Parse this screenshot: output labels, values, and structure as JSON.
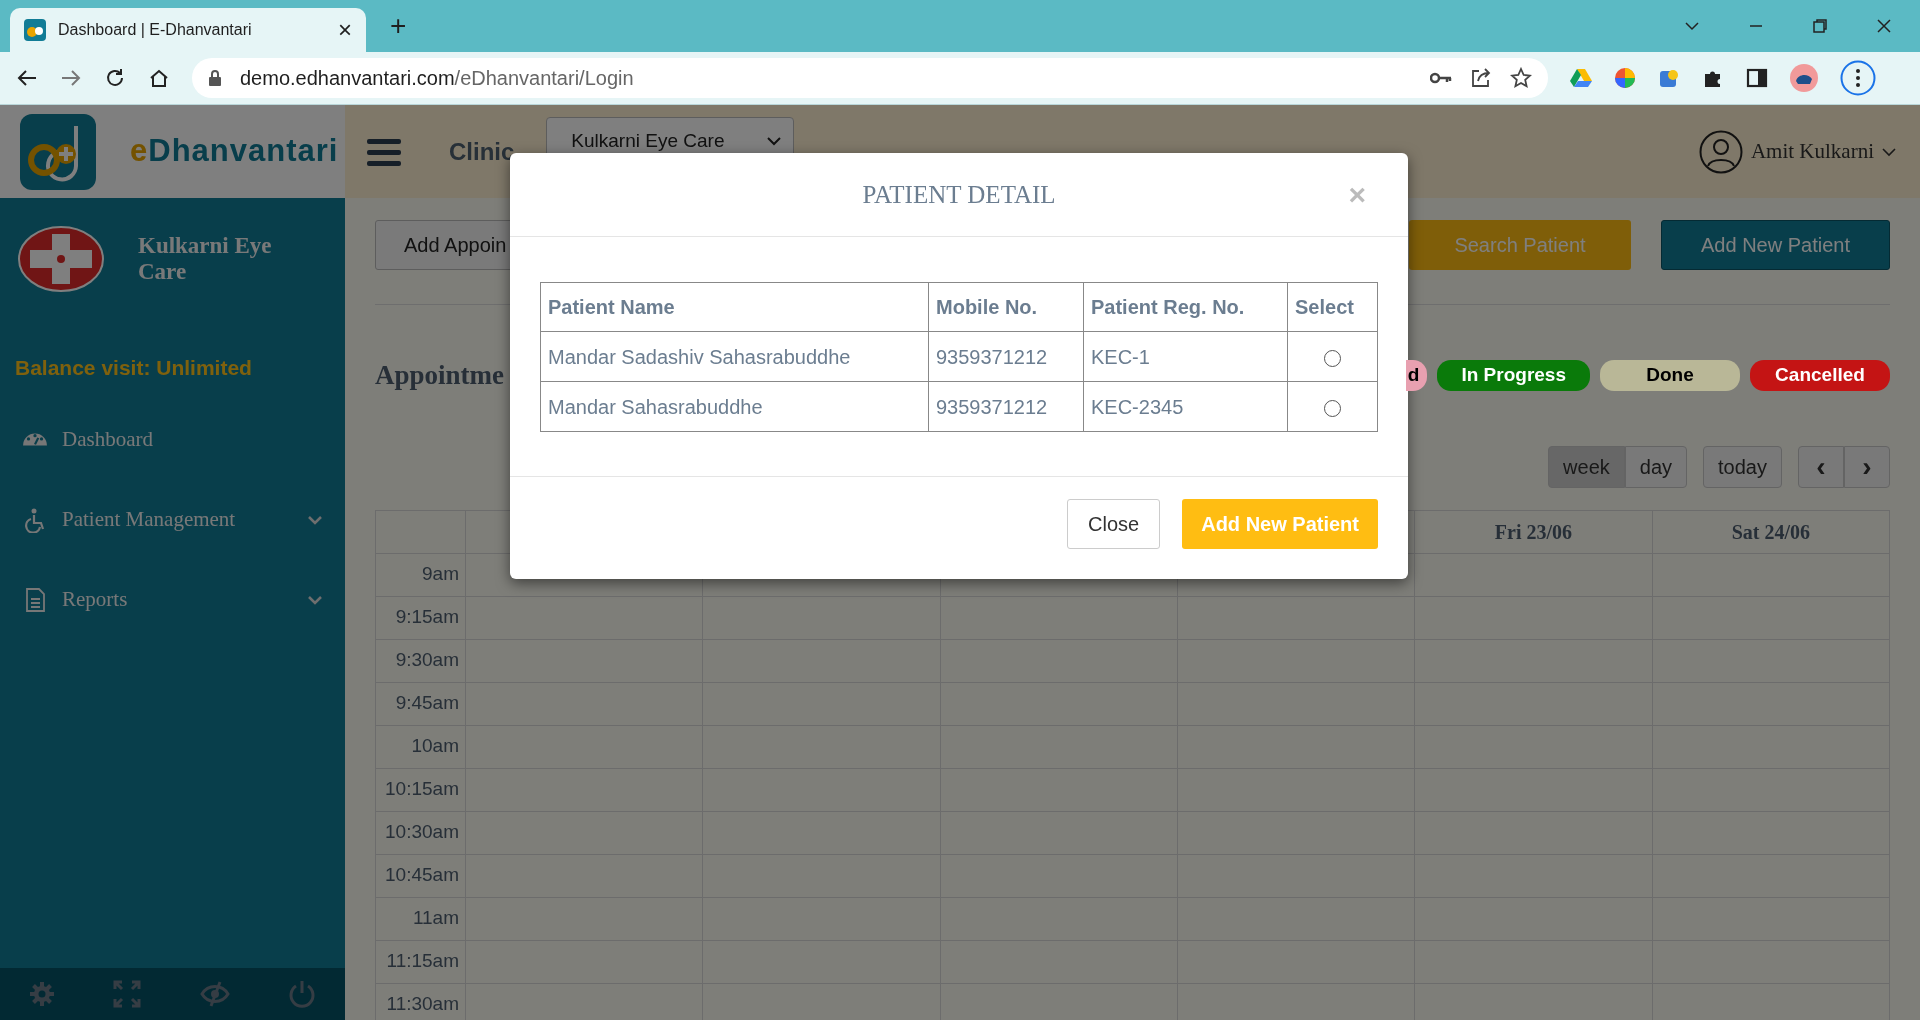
{
  "browser": {
    "tab_title": "Dashboard | E-Dhanvantari",
    "tab_close": "×",
    "new_tab": "+",
    "url_host": "demo.edhanvantari.com",
    "url_path": "/eDhanvantari/Login"
  },
  "app": {
    "brand_prefix": "e",
    "brand_rest": "Dhanvantari",
    "header_label": "Clinic",
    "clinic_select": "Kulkarni Eye Care",
    "user_name": "Amit Kulkarni"
  },
  "sidebar": {
    "clinic_name": "Kulkarni Eye Care",
    "balance": "Balance visit: Unlimited",
    "items": [
      {
        "label": "Dashboard",
        "kind": "dashboard"
      },
      {
        "label": "Patient Management",
        "kind": "patients",
        "expanded": false
      },
      {
        "label": "Reports",
        "kind": "reports",
        "expanded": false
      }
    ]
  },
  "main": {
    "add_button": "Add Appoin",
    "search_button": "Search Patient",
    "add_patient_button": "Add New Patient",
    "title": "Appointme",
    "legend": [
      {
        "label": "d",
        "color": "#e8a0b0"
      },
      {
        "label": "In Progress",
        "color": "#0a7a0a"
      },
      {
        "label": "Done",
        "color": "#b9b797"
      },
      {
        "label": "Cancelled",
        "color": "#c41414"
      }
    ],
    "views": [
      {
        "label": "week",
        "selected": true
      },
      {
        "label": "day",
        "selected": false
      }
    ],
    "today": "today",
    "prev": "‹",
    "next": "›",
    "day_headers": [
      "Fri 23/06",
      "Sat 24/06"
    ],
    "times": [
      "9am",
      "9:15am",
      "9:30am",
      "9:45am",
      "10am",
      "10:15am",
      "10:30am",
      "10:45am",
      "11am",
      "11:15am",
      "11:30am"
    ]
  },
  "modal": {
    "title": "PATIENT DETAIL",
    "close_symbol": "×",
    "columns": [
      "Patient Name",
      "Mobile No.",
      "Patient Reg. No.",
      "Select"
    ],
    "rows": [
      {
        "name": "Mandar Sadashiv Sahasrabuddhe",
        "mobile": "9359371212",
        "reg_no": "KEC-1",
        "selected": false
      },
      {
        "name": "Mandar Sahasrabuddhe",
        "mobile": "9359371212",
        "reg_no": "KEC-2345",
        "selected": false
      }
    ],
    "buttons": [
      {
        "label": "Close",
        "kind": "secondary"
      },
      {
        "label": "Add New Patient",
        "kind": "primary"
      }
    ]
  }
}
